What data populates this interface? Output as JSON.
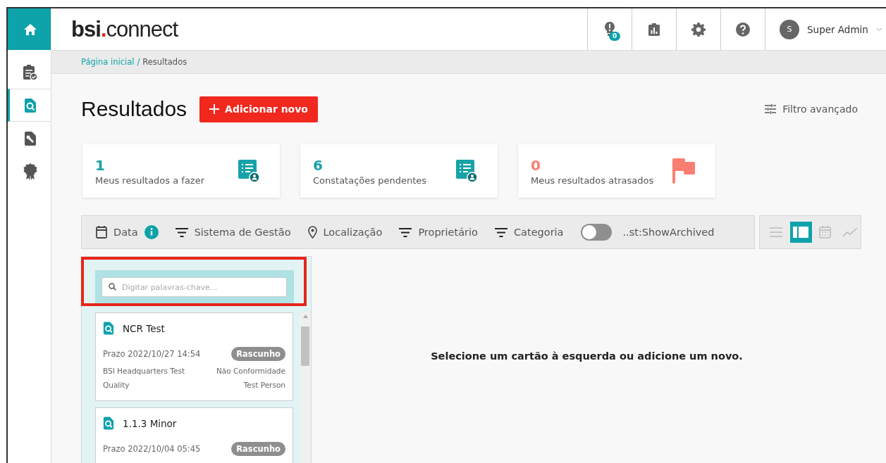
{
  "sidebar": {
    "items": [
      {
        "kind": "home",
        "selected": false
      },
      {
        "kind": "tasks",
        "selected": false
      },
      {
        "kind": "results",
        "selected": true
      },
      {
        "kind": "tools",
        "selected": false
      },
      {
        "kind": "award",
        "selected": false
      }
    ]
  },
  "header": {
    "logo_main": "bsi",
    "logo_dot": ".",
    "logo_rest": "connect",
    "notification_count": "0",
    "user_initial": "S",
    "user_name": "Super Admin"
  },
  "breadcrumb": {
    "link": "Página inicial",
    "separator": "/",
    "current": "Resultados"
  },
  "page": {
    "title": "Resultados",
    "add_button": "Adicionar novo",
    "advanced_filter": "Filtro avançado"
  },
  "stats": [
    {
      "value": "1",
      "label": "Meus resultados a fazer",
      "kind": "list",
      "color": "#17a2a9"
    },
    {
      "value": "6",
      "label": "Constatações pendentes",
      "kind": "list",
      "color": "#17a2a9"
    },
    {
      "value": "0",
      "label": "Meus resultados atrasados",
      "kind": "flag",
      "color": "#fa7f72"
    }
  ],
  "filters": [
    {
      "kind": "date",
      "label": "Data"
    },
    {
      "kind": "filter",
      "label": "Sistema de Gestão"
    },
    {
      "kind": "location",
      "label": "Localização"
    },
    {
      "kind": "filter",
      "label": "Proprietário"
    },
    {
      "kind": "filter",
      "label": "Categoria"
    }
  ],
  "archived_toggle": {
    "on": false,
    "label": "..st:ShowArchived"
  },
  "views": [
    {
      "kind": "list",
      "selected": false
    },
    {
      "kind": "kanban",
      "selected": true
    },
    {
      "kind": "calendar",
      "selected": false
    },
    {
      "kind": "chart",
      "selected": false
    }
  ],
  "search": {
    "placeholder": "Digitar palavras-chave..."
  },
  "cards": [
    {
      "title": "NCR Test",
      "due": "Prazo 2022/10/27 14:54",
      "status": "Rascunho",
      "location": "BSI Headquarters Test",
      "type": "Não Conformidade",
      "category": "Quality",
      "owner": "Test Person"
    },
    {
      "title": "1.1.3 Minor",
      "due": "Prazo 2022/10/04 05:45",
      "status": "Rascunho"
    }
  ],
  "empty_message": "Selecione um cartão à esquerda ou adicione um novo."
}
